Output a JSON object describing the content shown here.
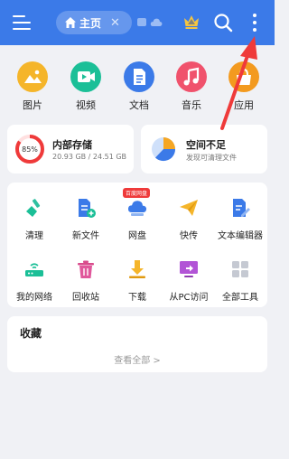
{
  "colors": {
    "brand": "#3b7ae8",
    "images": "#f5b52a",
    "video": "#1bbf97",
    "docs": "#3b7ae8",
    "music": "#f0526c",
    "apps": "#f39a1f",
    "arrow": "#ef3a3a"
  },
  "topbar": {
    "tab_label": "主页",
    "close_symbol": "✕"
  },
  "categories": [
    {
      "label": "图片",
      "icon": "image-icon"
    },
    {
      "label": "视频",
      "icon": "video-icon"
    },
    {
      "label": "文档",
      "icon": "document-icon"
    },
    {
      "label": "音乐",
      "icon": "music-icon"
    },
    {
      "label": "应用",
      "icon": "app-icon"
    }
  ],
  "storage": {
    "title": "内部存储",
    "percent": "85%",
    "percent_fill": 0.85,
    "detail": "20.93 GB / 24.51 GB"
  },
  "space": {
    "title": "空间不足",
    "detail": "发现可清理文件"
  },
  "tools": [
    {
      "label": "清理",
      "icon": "broom-icon"
    },
    {
      "label": "新文件",
      "icon": "new-file-icon"
    },
    {
      "label": "网盘",
      "icon": "cloud-drive-icon",
      "badge": "百度网盘"
    },
    {
      "label": "快传",
      "icon": "send-icon"
    },
    {
      "label": "文本编辑器",
      "icon": "text-editor-icon"
    },
    {
      "label": "我的网络",
      "icon": "router-icon"
    },
    {
      "label": "回收站",
      "icon": "trash-icon"
    },
    {
      "label": "下载",
      "icon": "download-icon"
    },
    {
      "label": "从PC访问",
      "icon": "pc-access-icon"
    },
    {
      "label": "全部工具",
      "icon": "all-tools-icon"
    }
  ],
  "favorites": {
    "title": "收藏",
    "view_all": "查看全部 >"
  }
}
